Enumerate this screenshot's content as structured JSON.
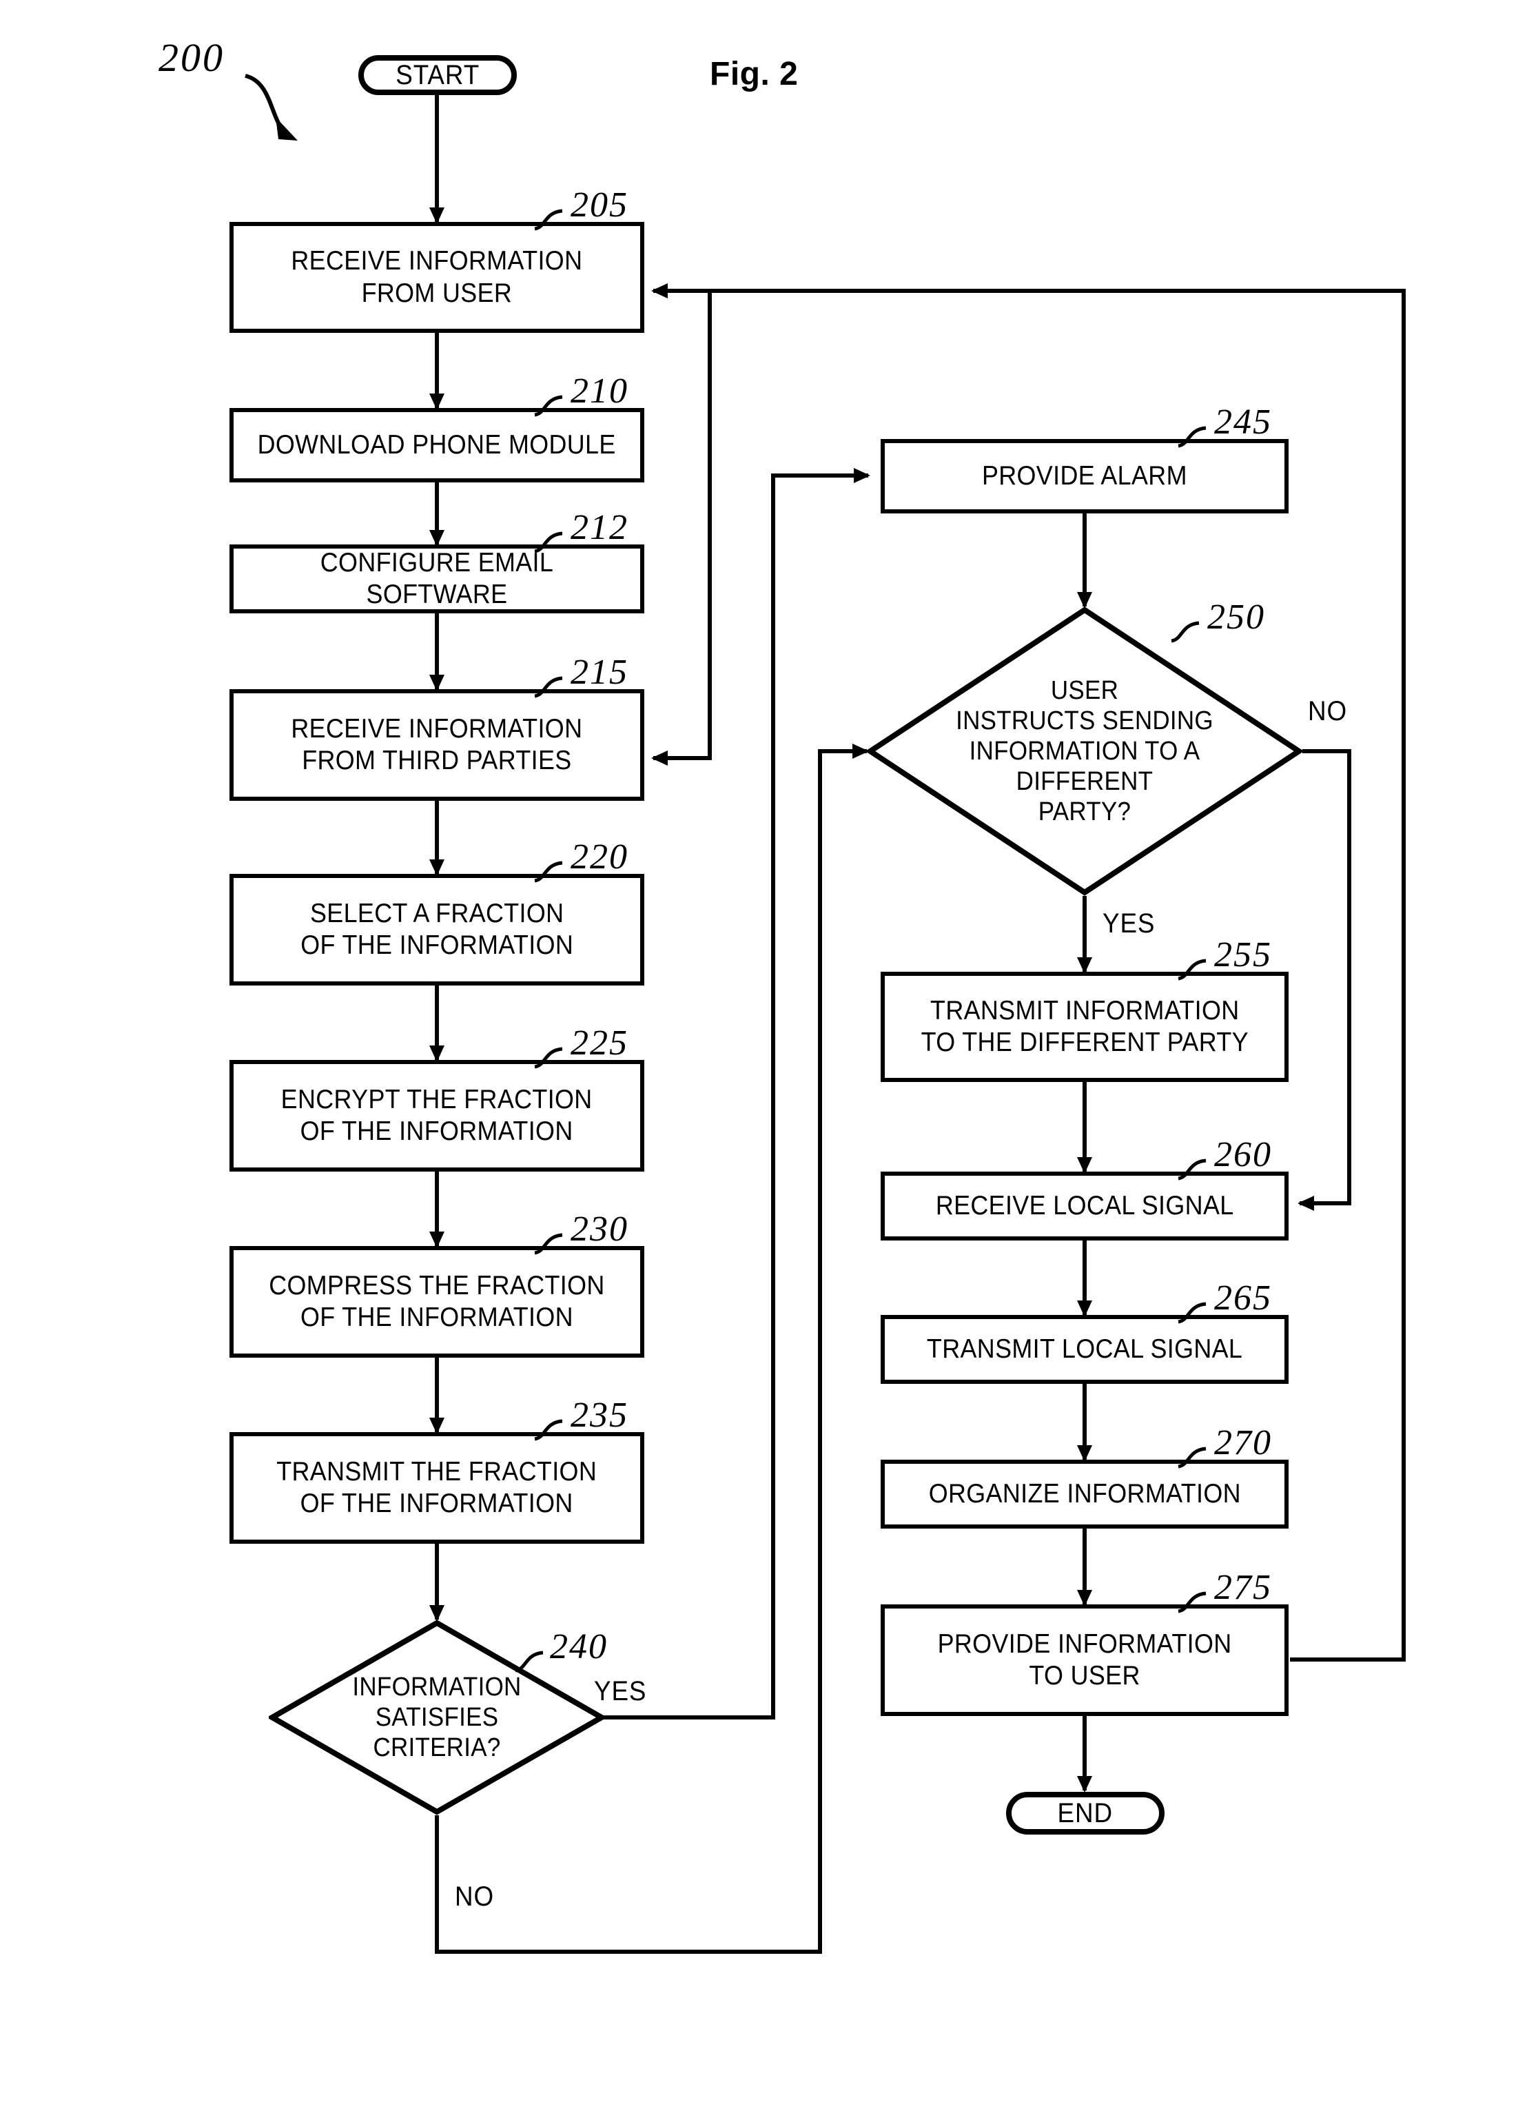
{
  "figure": {
    "title": "Fig. 2",
    "tag": "200"
  },
  "terminals": {
    "start": "START",
    "end": "END"
  },
  "steps": [
    {
      "ref": "205",
      "text": "RECEIVE INFORMATION\nFROM USER"
    },
    {
      "ref": "210",
      "text": "DOWNLOAD PHONE MODULE"
    },
    {
      "ref": "212",
      "text": "CONFIGURE EMAIL SOFTWARE"
    },
    {
      "ref": "215",
      "text": "RECEIVE INFORMATION\nFROM THIRD PARTIES"
    },
    {
      "ref": "220",
      "text": "SELECT A FRACTION\nOF THE INFORMATION"
    },
    {
      "ref": "225",
      "text": "ENCRYPT THE FRACTION\nOF THE INFORMATION"
    },
    {
      "ref": "230",
      "text": "COMPRESS THE FRACTION\nOF THE INFORMATION"
    },
    {
      "ref": "235",
      "text": "TRANSMIT THE FRACTION\nOF THE INFORMATION"
    },
    {
      "ref": "245",
      "text": "PROVIDE ALARM"
    },
    {
      "ref": "255",
      "text": "TRANSMIT INFORMATION\nTO THE DIFFERENT PARTY"
    },
    {
      "ref": "260",
      "text": "RECEIVE LOCAL SIGNAL"
    },
    {
      "ref": "265",
      "text": "TRANSMIT LOCAL SIGNAL"
    },
    {
      "ref": "270",
      "text": "ORGANIZE INFORMATION"
    },
    {
      "ref": "275",
      "text": "PROVIDE INFORMATION\nTO USER"
    }
  ],
  "decisions": [
    {
      "ref": "240",
      "text": "INFORMATION\nSATISFIES\nCRITERIA?",
      "yes": "YES",
      "no": "NO"
    },
    {
      "ref": "250",
      "text": "USER\nINSTRUCTS SENDING\nINFORMATION TO A\nDIFFERENT\nPARTY?",
      "yes": "YES",
      "no": "NO"
    }
  ],
  "chart_data": {
    "type": "diagram",
    "title": "Fig. 2",
    "nodes": [
      {
        "id": "start",
        "shape": "terminal",
        "label": "START"
      },
      {
        "id": "205",
        "shape": "process",
        "label": "RECEIVE INFORMATION FROM USER"
      },
      {
        "id": "210",
        "shape": "process",
        "label": "DOWNLOAD PHONE MODULE"
      },
      {
        "id": "212",
        "shape": "process",
        "label": "CONFIGURE EMAIL SOFTWARE"
      },
      {
        "id": "215",
        "shape": "process",
        "label": "RECEIVE INFORMATION FROM THIRD PARTIES"
      },
      {
        "id": "220",
        "shape": "process",
        "label": "SELECT A FRACTION OF THE INFORMATION"
      },
      {
        "id": "225",
        "shape": "process",
        "label": "ENCRYPT THE FRACTION OF THE INFORMATION"
      },
      {
        "id": "230",
        "shape": "process",
        "label": "COMPRESS THE FRACTION OF THE INFORMATION"
      },
      {
        "id": "235",
        "shape": "process",
        "label": "TRANSMIT THE FRACTION OF THE INFORMATION"
      },
      {
        "id": "240",
        "shape": "decision",
        "label": "INFORMATION SATISFIES CRITERIA?"
      },
      {
        "id": "245",
        "shape": "process",
        "label": "PROVIDE ALARM"
      },
      {
        "id": "250",
        "shape": "decision",
        "label": "USER INSTRUCTS SENDING INFORMATION TO A DIFFERENT PARTY?"
      },
      {
        "id": "255",
        "shape": "process",
        "label": "TRANSMIT INFORMATION TO THE DIFFERENT PARTY"
      },
      {
        "id": "260",
        "shape": "process",
        "label": "RECEIVE LOCAL SIGNAL"
      },
      {
        "id": "265",
        "shape": "process",
        "label": "TRANSMIT LOCAL SIGNAL"
      },
      {
        "id": "270",
        "shape": "process",
        "label": "ORGANIZE INFORMATION"
      },
      {
        "id": "275",
        "shape": "process",
        "label": "PROVIDE INFORMATION TO USER"
      },
      {
        "id": "end",
        "shape": "terminal",
        "label": "END"
      }
    ],
    "edges": [
      {
        "from": "start",
        "to": "205",
        "label": ""
      },
      {
        "from": "205",
        "to": "210",
        "label": ""
      },
      {
        "from": "210",
        "to": "212",
        "label": ""
      },
      {
        "from": "212",
        "to": "215",
        "label": ""
      },
      {
        "from": "215",
        "to": "220",
        "label": ""
      },
      {
        "from": "220",
        "to": "225",
        "label": ""
      },
      {
        "from": "225",
        "to": "230",
        "label": ""
      },
      {
        "from": "230",
        "to": "235",
        "label": ""
      },
      {
        "from": "235",
        "to": "240",
        "label": ""
      },
      {
        "from": "240",
        "to": "245",
        "label": "YES"
      },
      {
        "from": "240",
        "to": "250",
        "label": "NO"
      },
      {
        "from": "245",
        "to": "250",
        "label": ""
      },
      {
        "from": "250",
        "to": "255",
        "label": "YES"
      },
      {
        "from": "250",
        "to": "260",
        "label": "NO"
      },
      {
        "from": "255",
        "to": "260",
        "label": ""
      },
      {
        "from": "260",
        "to": "265",
        "label": ""
      },
      {
        "from": "265",
        "to": "270",
        "label": ""
      },
      {
        "from": "270",
        "to": "275",
        "label": ""
      },
      {
        "from": "275",
        "to": "end",
        "label": ""
      },
      {
        "from": "275",
        "to": "205",
        "label": ""
      },
      {
        "from": "245",
        "to": "215",
        "label": ""
      }
    ]
  }
}
